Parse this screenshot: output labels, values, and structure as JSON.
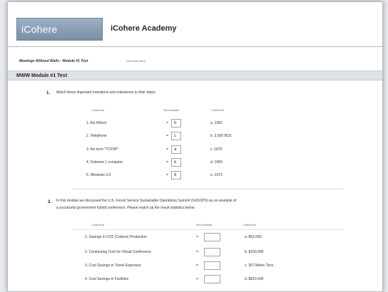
{
  "header": {
    "logo_text": "iCohere Academy",
    "site_title": "iCohere Academy"
  },
  "breadcrumb": {
    "title": "Meetings Without Walls - Module #1 Test",
    "link": "(view test intro)"
  },
  "section_title": "MWW Module #1 Test",
  "q1": {
    "number": "1.",
    "text": "Match these important inventions and milestones to their dates.",
    "col_a": "Column A",
    "col_answer": "Your Answer",
    "col_b": "Column B",
    "rows": [
      {
        "a": "1. the Wheel",
        "answer": "b",
        "b": "a. 1982"
      },
      {
        "a": "2. Telephone",
        "answer": "c",
        "b": "b. 3,500 BCE"
      },
      {
        "a": "3. the term \"TCP/IP\"",
        "answer": "a",
        "b": "c. 1876"
      },
      {
        "a": "4. Osborne 1 computer",
        "answer": "e",
        "b": "d. 1990"
      },
      {
        "a": "5. Windows 3.0",
        "answer": "d",
        "b": "e. 1973"
      }
    ]
  },
  "q2": {
    "number": "2.",
    "text_line1": "In this module we discussed the U.S. Forest Service Sustainable Operations Summit (SUSOPS) as an example of",
    "text_line2": "a successful government hybrid conference. Please match up the result statistics below.",
    "col_a": "Column A",
    "col_answer": "Your Answer",
    "col_b": "Column B",
    "rows": [
      {
        "a": "1. Savings in CO2 (Carbon) Production",
        "b": "a. $52,000"
      },
      {
        "a": "2. Contracting Cost for Virtual Conference",
        "b": "b. $150,000"
      },
      {
        "a": "3. Cost Savings in Travel Expenses",
        "b": "c. 357 Metric Tons"
      },
      {
        "a": "4. Cost Savings in Facilities",
        "b": "d. $810,000"
      }
    ]
  },
  "eq_sign": "="
}
